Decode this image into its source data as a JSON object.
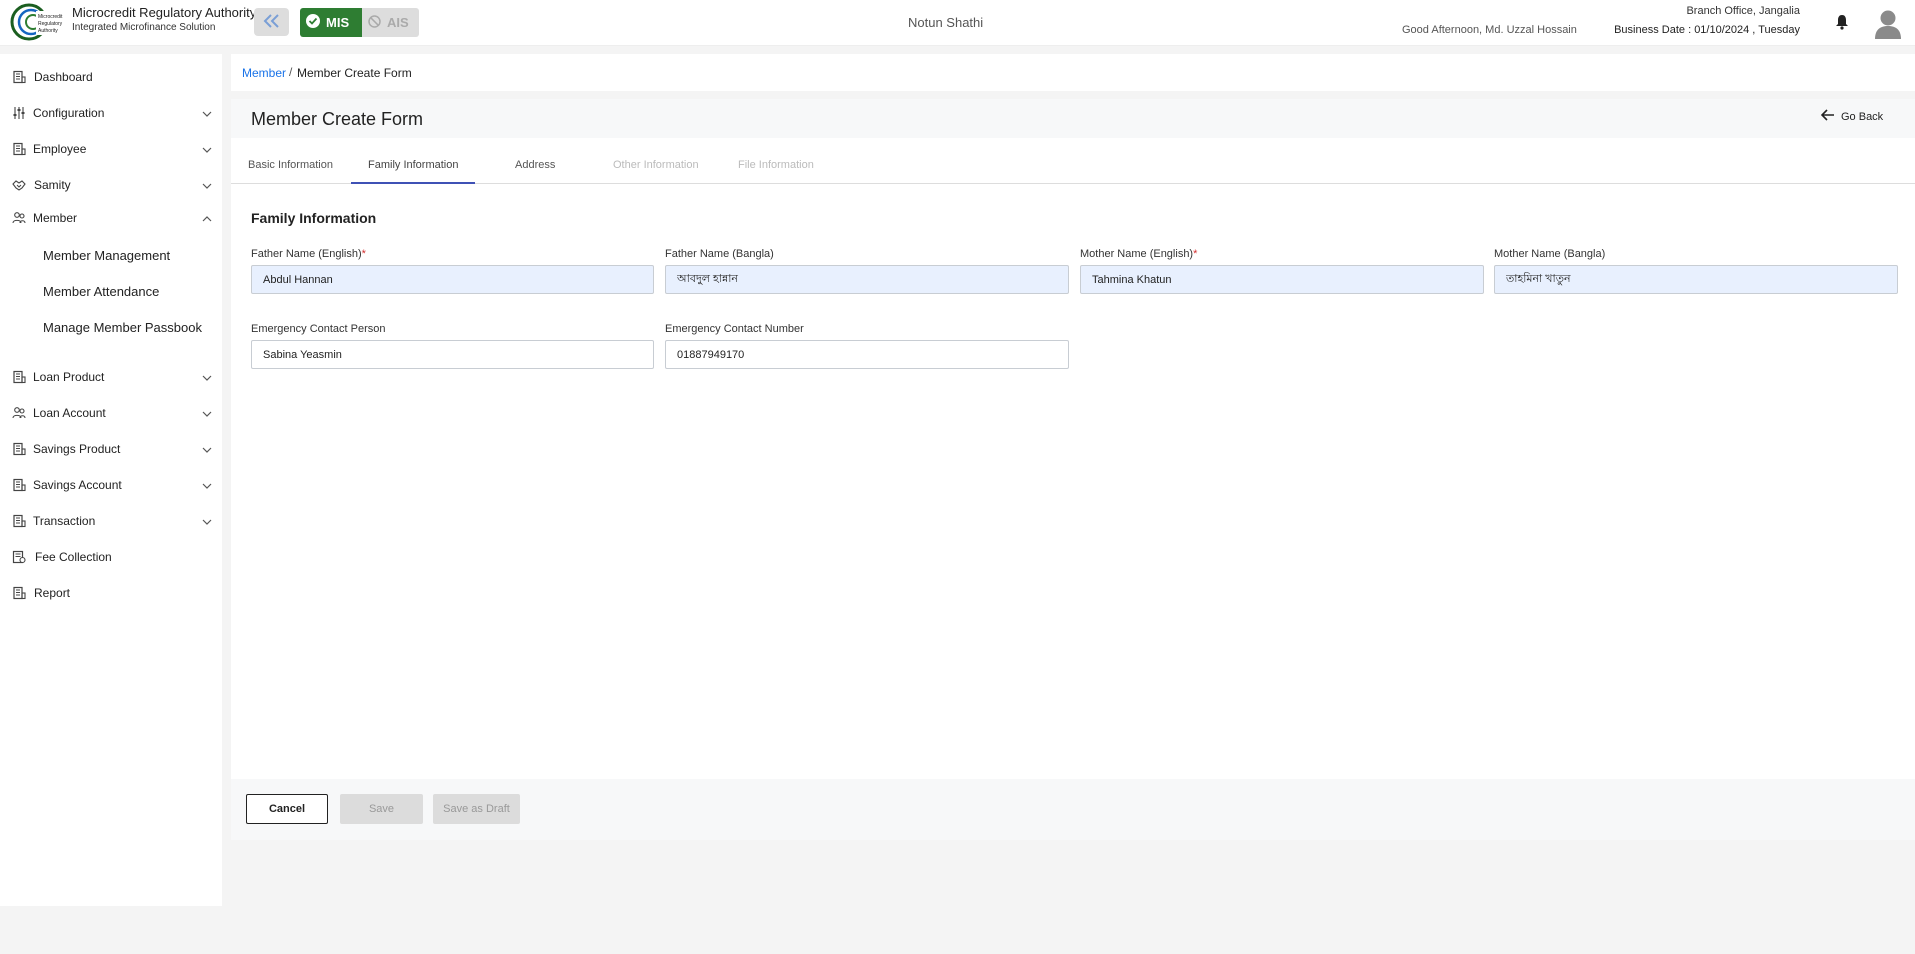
{
  "header": {
    "org_name": "Microcredit Regulatory Authority",
    "org_sub": "Integrated Microfinance Solution",
    "logo_text": "Microcredit Regulatory Authority",
    "mis_label": "MIS",
    "ais_label": "AIS",
    "app_title": "Notun Shathi",
    "greeting": "Good Afternoon, Md. Uzzal Hossain",
    "branch": "Branch Office, Jangalia",
    "business_date": "Business Date : 01/10/2024 , Tuesday"
  },
  "sidebar": {
    "items": [
      {
        "label": "Dashboard",
        "icon": "building-icon",
        "expandable": false
      },
      {
        "label": "Configuration",
        "icon": "sliders-icon",
        "expandable": true
      },
      {
        "label": "Employee",
        "icon": "building-icon",
        "expandable": true
      },
      {
        "label": "Samity",
        "icon": "handshake-icon",
        "expandable": true
      },
      {
        "label": "Member",
        "icon": "people-icon",
        "expandable": true,
        "expanded": true
      },
      {
        "label": "Loan Product",
        "icon": "building-icon",
        "expandable": true
      },
      {
        "label": "Loan Account",
        "icon": "people-icon",
        "expandable": true
      },
      {
        "label": "Savings Product",
        "icon": "building-icon",
        "expandable": true
      },
      {
        "label": "Savings Account",
        "icon": "building-icon",
        "expandable": true
      },
      {
        "label": "Transaction",
        "icon": "building-icon",
        "expandable": true
      },
      {
        "label": "Fee Collection",
        "icon": "fee-icon",
        "expandable": false
      },
      {
        "label": "Report",
        "icon": "building-icon",
        "expandable": false
      }
    ],
    "member_subitems": [
      "Member Management",
      "Member Attendance",
      "Manage Member Passbook"
    ]
  },
  "breadcrumb": {
    "parent": "Member",
    "separator": "/",
    "current": "Member Create Form"
  },
  "page": {
    "title": "Member Create Form",
    "go_back": "Go Back"
  },
  "tabs": [
    {
      "label": "Basic Information",
      "state": "normal"
    },
    {
      "label": "Family Information",
      "state": "active"
    },
    {
      "label": "Address",
      "state": "normal"
    },
    {
      "label": "Other Information",
      "state": "disabled"
    },
    {
      "label": "File Information",
      "state": "disabled"
    }
  ],
  "form": {
    "section_title": "Family Information",
    "required_mark": "*",
    "fields": {
      "father_en": {
        "label": "Father Name (English)",
        "value": "Abdul Hannan",
        "required": true
      },
      "father_bn": {
        "label": "Father Name (Bangla)",
        "value": "আবদুল হান্নান",
        "required": false
      },
      "mother_en": {
        "label": "Mother Name (English)",
        "value": "Tahmina Khatun",
        "required": true
      },
      "mother_bn": {
        "label": "Mother Name (Bangla)",
        "value": "তাহমিনা খাতুন",
        "required": false
      },
      "emergency_person": {
        "label": "Emergency Contact Person",
        "value": "Sabina Yeasmin",
        "required": false
      },
      "emergency_number": {
        "label": "Emergency Contact Number",
        "value": "01887949170",
        "required": false
      }
    }
  },
  "footer": {
    "cancel": "Cancel",
    "save": "Save",
    "save_draft": "Save as Draft"
  },
  "colors": {
    "accent": "#1a73e8",
    "mis_green": "#2e7d32",
    "tab_underline": "#3f51b5",
    "filled_input": "#e8f0fe",
    "required": "#d32f2f"
  }
}
